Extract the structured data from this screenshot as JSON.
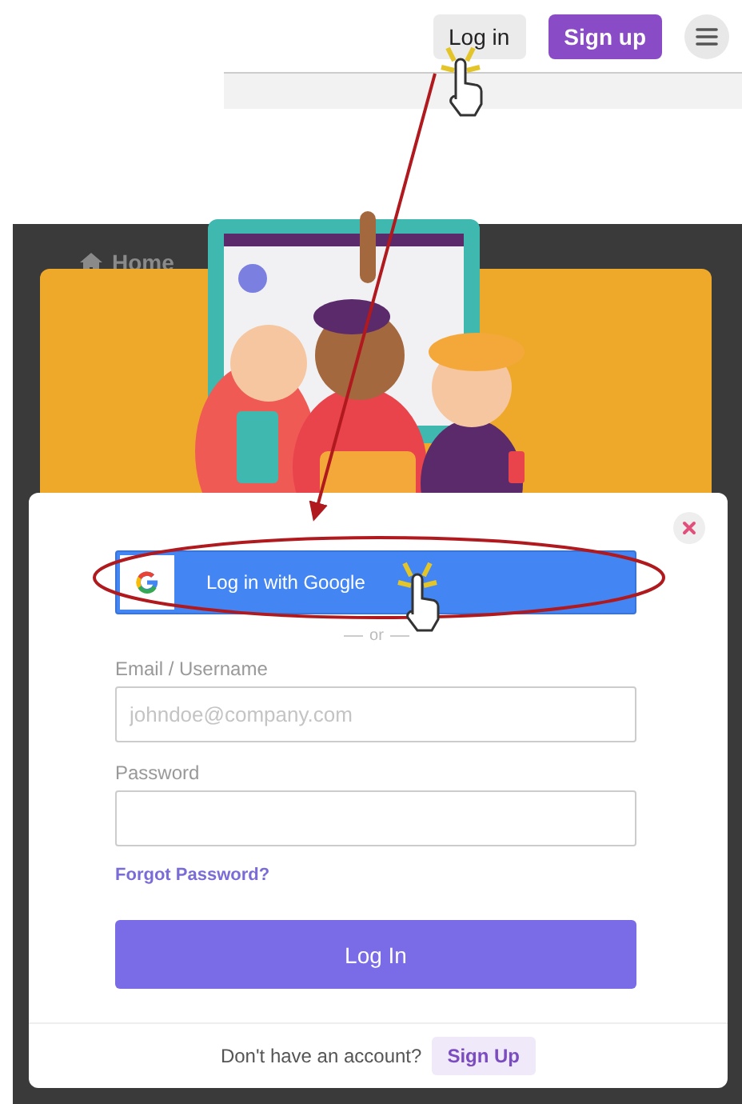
{
  "header": {
    "buttons": [
      {
        "label": "Log in",
        "kind": "secondary"
      },
      {
        "label": "Sign up",
        "kind": "primary"
      }
    ]
  },
  "background": {
    "nav_item": "Home"
  },
  "modal": {
    "google_button": "Log in with Google",
    "divider": "or",
    "fields": [
      {
        "label": "Email / Username",
        "placeholder": "johndoe@company.com"
      },
      {
        "label": "Password"
      }
    ],
    "forgot_link": "Forgot Password?",
    "submit_button": "Log In",
    "footer": {
      "prompt": "Don't have an account?",
      "link": "Sign Up"
    }
  }
}
